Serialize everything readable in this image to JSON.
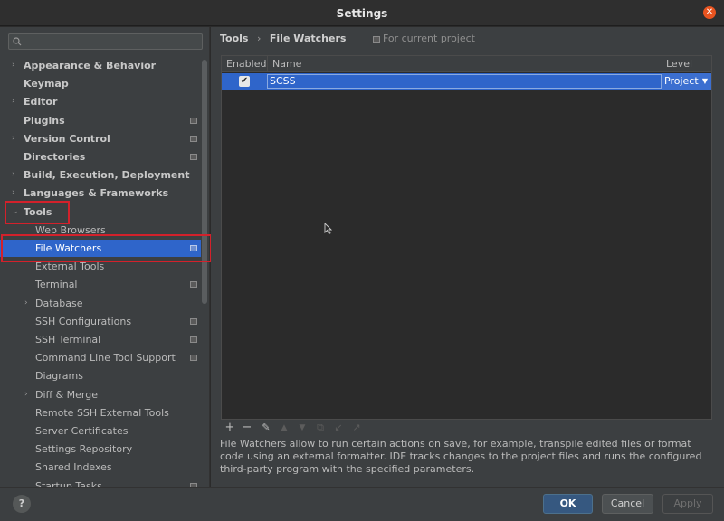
{
  "window": {
    "title": "Settings"
  },
  "sidebar": {
    "items": [
      {
        "label": "Appearance & Behavior",
        "arrow": "›",
        "level": "top",
        "project": false
      },
      {
        "label": "Keymap",
        "arrow": "",
        "level": "top",
        "project": false
      },
      {
        "label": "Editor",
        "arrow": "›",
        "level": "top",
        "project": false
      },
      {
        "label": "Plugins",
        "arrow": "",
        "level": "top",
        "project": true
      },
      {
        "label": "Version Control",
        "arrow": "›",
        "level": "top",
        "project": true
      },
      {
        "label": "Directories",
        "arrow": "",
        "level": "top",
        "project": true
      },
      {
        "label": "Build, Execution, Deployment",
        "arrow": "›",
        "level": "top",
        "project": false
      },
      {
        "label": "Languages & Frameworks",
        "arrow": "›",
        "level": "top",
        "project": false
      },
      {
        "label": "Tools",
        "arrow": "⌄",
        "level": "top",
        "project": false
      },
      {
        "label": "Web Browsers",
        "arrow": "",
        "level": "sub",
        "project": false
      },
      {
        "label": "File Watchers",
        "arrow": "",
        "level": "sub",
        "project": true,
        "selected": true
      },
      {
        "label": "External Tools",
        "arrow": "",
        "level": "sub",
        "project": false
      },
      {
        "label": "Terminal",
        "arrow": "",
        "level": "sub",
        "project": true
      },
      {
        "label": "Database",
        "arrow": "›",
        "level": "sub",
        "project": false
      },
      {
        "label": "SSH Configurations",
        "arrow": "",
        "level": "sub",
        "project": true
      },
      {
        "label": "SSH Terminal",
        "arrow": "",
        "level": "sub",
        "project": true
      },
      {
        "label": "Command Line Tool Support",
        "arrow": "",
        "level": "sub",
        "project": true
      },
      {
        "label": "Diagrams",
        "arrow": "",
        "level": "sub",
        "project": false
      },
      {
        "label": "Diff & Merge",
        "arrow": "›",
        "level": "sub",
        "project": false
      },
      {
        "label": "Remote SSH External Tools",
        "arrow": "",
        "level": "sub",
        "project": false
      },
      {
        "label": "Server Certificates",
        "arrow": "",
        "level": "sub",
        "project": false
      },
      {
        "label": "Settings Repository",
        "arrow": "",
        "level": "sub",
        "project": false
      },
      {
        "label": "Shared Indexes",
        "arrow": "",
        "level": "sub",
        "project": false
      },
      {
        "label": "Startup Tasks",
        "arrow": "",
        "level": "sub",
        "project": true
      }
    ]
  },
  "breadcrumb": {
    "parent": "Tools",
    "separator": "›",
    "current": "File Watchers",
    "scope": "For current project"
  },
  "table": {
    "columns": {
      "enabled": "Enabled",
      "name": "Name",
      "level": "Level"
    },
    "rows": [
      {
        "enabled": true,
        "checkmark": "✔",
        "name": "SCSS",
        "level": "Project",
        "dropdown": "▼"
      }
    ]
  },
  "toolbar": {
    "add": "+",
    "remove": "−",
    "edit": "✎",
    "move_up": "▲",
    "move_down": "▼",
    "copy": "⧉",
    "import": "↙",
    "export": "↗"
  },
  "description": "File Watchers allow to run certain actions on save, for example, transpile edited files or format code using an external formatter. IDE tracks changes to the project files and runs the configured third-party program with the specified parameters.",
  "footer": {
    "help": "?",
    "ok": "OK",
    "cancel": "Cancel",
    "apply": "Apply"
  },
  "icons": {
    "close": "close-icon",
    "search": "search-icon",
    "help": "help-icon"
  },
  "colors": {
    "selection": "#2f65ca",
    "highlight": "#d3212b",
    "ok_button": "#365880",
    "close_button": "#e95420"
  }
}
